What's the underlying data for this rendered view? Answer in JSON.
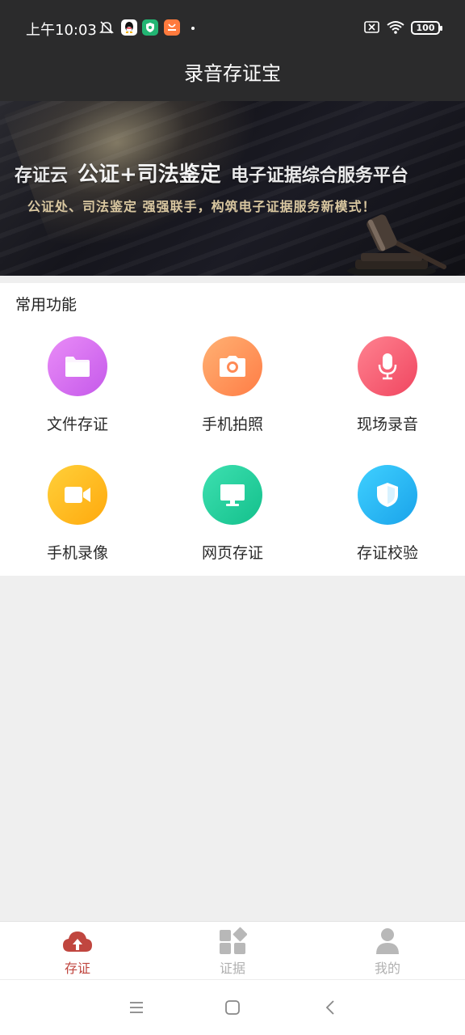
{
  "status_bar": {
    "time": "上午10:03",
    "battery": "100",
    "icons": [
      "alarm-off-icon",
      "qq-icon",
      "shield-app-icon",
      "orange-app-icon",
      "dot-icon",
      "sim-x-icon",
      "wifi-icon",
      "battery-icon"
    ]
  },
  "header": {
    "title": "录音存证宝"
  },
  "banner": {
    "part1": "存证云",
    "part2": "公证+司法鉴定",
    "part3": "电子证据综合服务平台",
    "subtitle": "公证处、司法鉴定 强强联手，构筑电子证据服务新模式！"
  },
  "functions": {
    "title": "常用功能",
    "items": [
      {
        "label": "文件存证",
        "icon": "folder-icon",
        "color": "#d46df0"
      },
      {
        "label": "手机拍照",
        "icon": "camera-icon",
        "color": "#ff8a55"
      },
      {
        "label": "现场录音",
        "icon": "microphone-icon",
        "color": "#f5566a"
      },
      {
        "label": "手机录像",
        "icon": "video-camera-icon",
        "color": "#ffbc1f"
      },
      {
        "label": "网页存证",
        "icon": "monitor-icon",
        "color": "#20d0a0"
      },
      {
        "label": "存证校验",
        "icon": "shield-icon",
        "color": "#22b6f2"
      }
    ]
  },
  "bottom_nav": {
    "items": [
      {
        "label": "存证",
        "icon": "cloud-upload-icon",
        "active": true,
        "color": "#c0463f"
      },
      {
        "label": "证据",
        "icon": "grid-icon",
        "active": false,
        "color": "#b0b0b0"
      },
      {
        "label": "我的",
        "icon": "person-icon",
        "active": false,
        "color": "#b0b0b0"
      }
    ]
  },
  "system_nav": {
    "icons": [
      "menu-icon",
      "home-icon",
      "back-icon"
    ]
  }
}
